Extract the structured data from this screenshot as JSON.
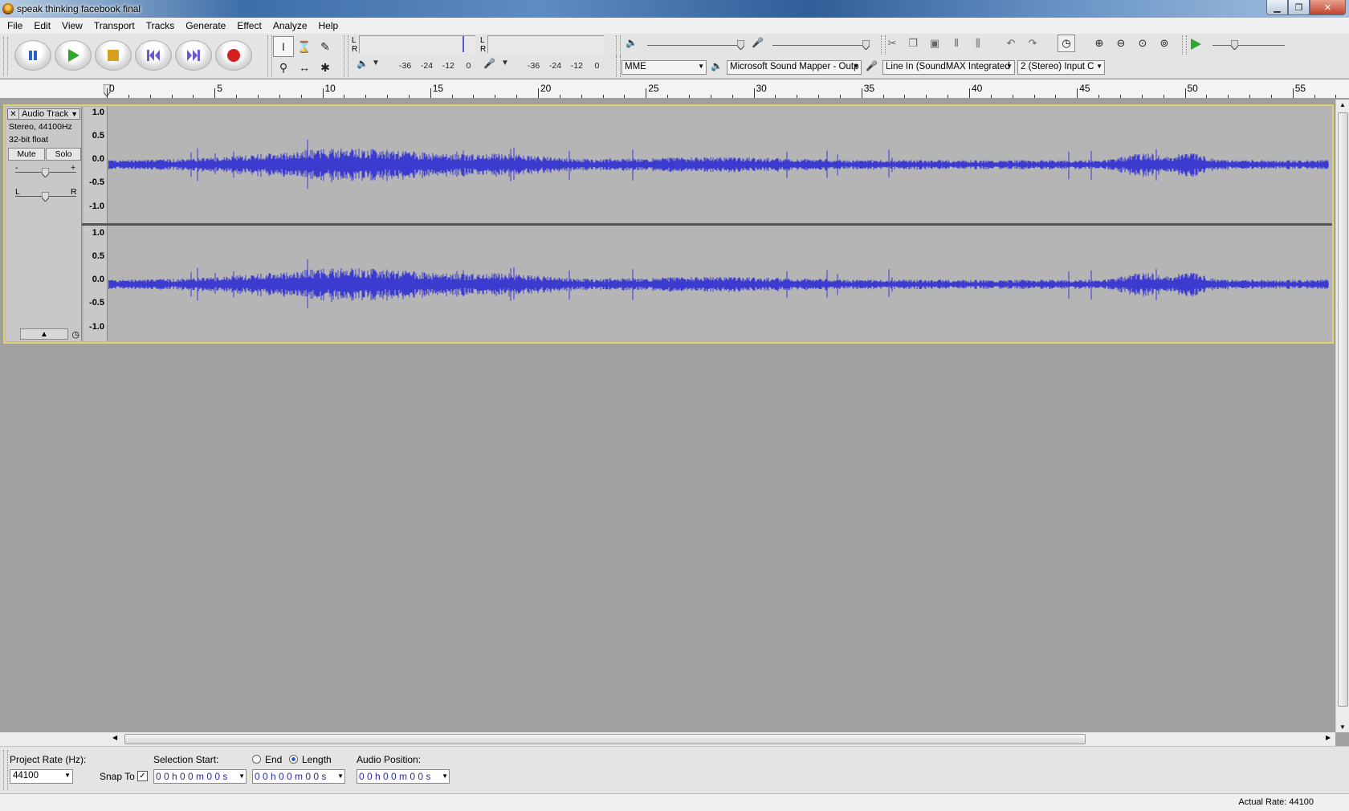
{
  "window": {
    "title": "speak thinking facebook final"
  },
  "menu": [
    "File",
    "Edit",
    "View",
    "Transport",
    "Tracks",
    "Generate",
    "Effect",
    "Analyze",
    "Help"
  ],
  "meters": {
    "channel_left": "L",
    "channel_right": "R",
    "play_ticks": [
      "-36",
      "-24",
      "-12",
      "0"
    ],
    "record_ticks": [
      "-36",
      "-24",
      "-12",
      "0"
    ]
  },
  "devices": {
    "host": "MME",
    "playback": "Microsoft Sound Mapper - Outp",
    "recording": "Line In (SoundMAX Integrated",
    "channels": "2 (Stereo) Input C"
  },
  "ruler": {
    "labels": [
      "0",
      "5",
      "10",
      "15",
      "20",
      "25",
      "30",
      "35",
      "40",
      "45",
      "50",
      "55"
    ]
  },
  "track": {
    "name": "Audio Track",
    "info_rate": "Stereo, 44100Hz",
    "info_format": "32-bit float",
    "mute": "Mute",
    "solo": "Solo",
    "gain_minus": "-",
    "gain_plus": "+",
    "pan_left": "L",
    "pan_right": "R",
    "amplitude_labels": [
      "1.0",
      "0.5",
      "0.0",
      "-0.5",
      "-1.0"
    ]
  },
  "selection_bar": {
    "project_rate_label": "Project Rate (Hz):",
    "project_rate": "44100",
    "snap_to": "Snap To",
    "selection_start": "Selection Start:",
    "end": "End",
    "length": "Length",
    "audio_position": "Audio Position:",
    "start_time": "0 0 h 0 0 m 0 0 s",
    "length_time": "0 0 h 0 0 m 0 0 s",
    "position_time": "0 0 h 0 0 m 0 0 s"
  },
  "status": {
    "actual_rate": "Actual Rate: 44100"
  },
  "colors": {
    "waveform": "#3b3bd0",
    "track_border": "#dfd36a",
    "record": "#d42020",
    "play": "#2fa82f"
  }
}
